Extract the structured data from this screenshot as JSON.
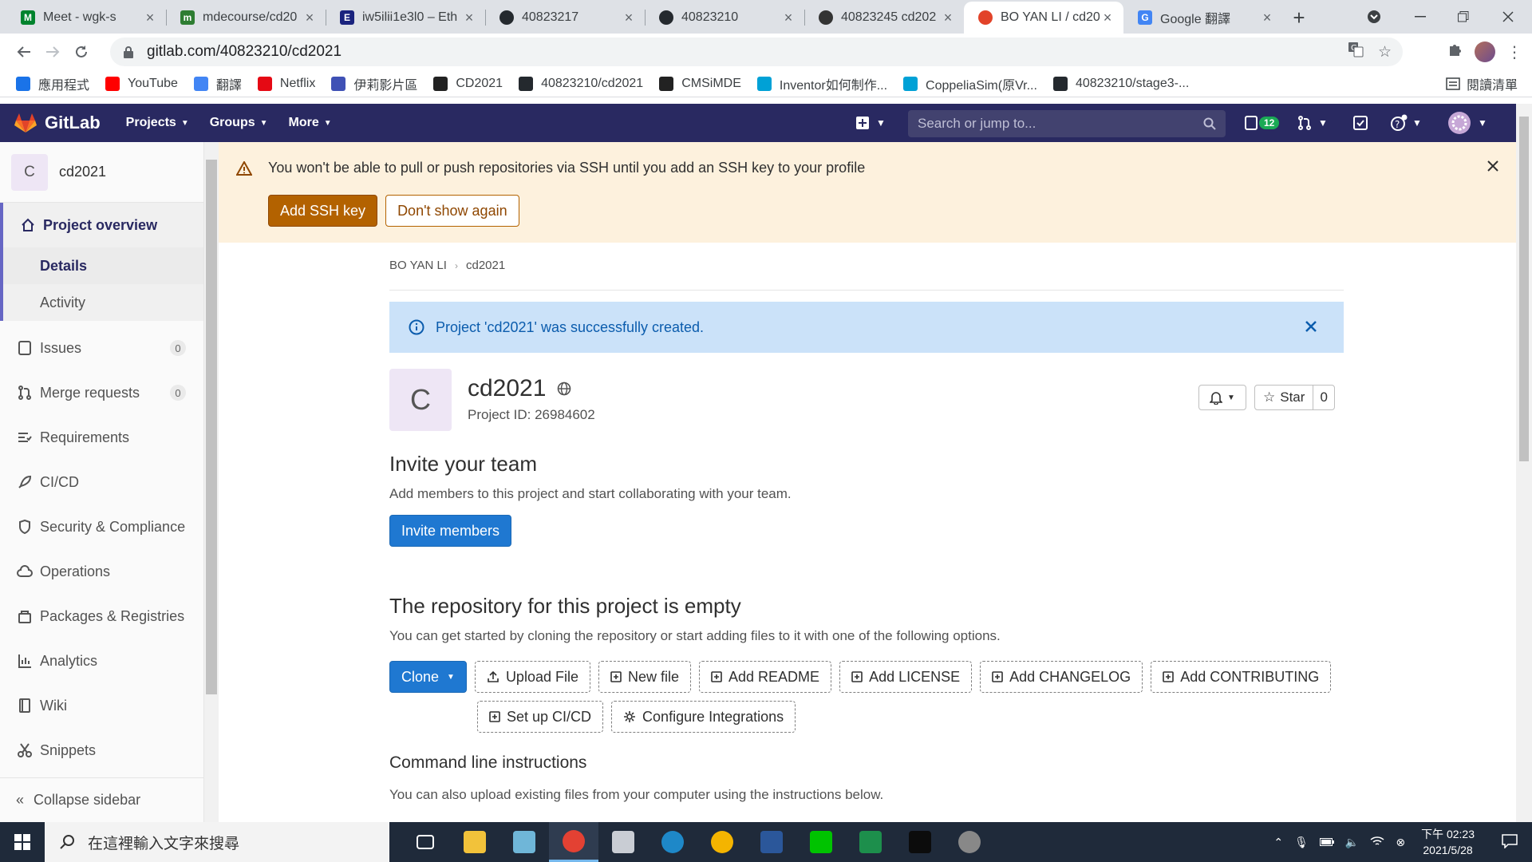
{
  "browser": {
    "tabs": [
      {
        "title": "Meet - wgk-s",
        "favicon_color": "#00832d",
        "favicon_letter": "M"
      },
      {
        "title": "mdecourse/cd20",
        "favicon_color": "#2e7d32",
        "favicon_letter": "m"
      },
      {
        "title": "iw5ilii1e3l0 – Eth",
        "favicon_color": "#1a237e",
        "favicon_letter": "E"
      },
      {
        "title": "40823217",
        "favicon_color": "#24292e",
        "favicon_letter": ""
      },
      {
        "title": "40823210",
        "favicon_color": "#24292e",
        "favicon_letter": ""
      },
      {
        "title": "40823245 cd202",
        "favicon_color": "#333333",
        "favicon_letter": ""
      },
      {
        "title": "BO YAN LI / cd20",
        "favicon_color": "#e24329",
        "favicon_letter": "",
        "active": true
      },
      {
        "title": "Google 翻譯",
        "favicon_color": "#4285f4",
        "favicon_letter": "G"
      }
    ],
    "url": "gitlab.com/40823210/cd2021",
    "bookmarks": [
      {
        "label": "應用程式",
        "icon": "apps-grid-icon",
        "color": "#1a73e8"
      },
      {
        "label": "YouTube",
        "icon": "youtube-icon",
        "color": "#ff0000"
      },
      {
        "label": "翻譯",
        "icon": "translate-icon",
        "color": "#4285f4"
      },
      {
        "label": "Netflix",
        "icon": "netflix-icon",
        "color": "#e50914"
      },
      {
        "label": "伊莉影片區",
        "icon": "eyny-icon",
        "color": "#3f51b5"
      },
      {
        "label": "CD2021",
        "icon": "cd-icon",
        "color": "#222222"
      },
      {
        "label": "40823210/cd2021",
        "icon": "github-icon",
        "color": "#24292e"
      },
      {
        "label": "CMSiMDE",
        "icon": "cms-icon",
        "color": "#222222"
      },
      {
        "label": "Inventor如何制作...",
        "icon": "bilibili-icon",
        "color": "#00a1d6"
      },
      {
        "label": "CoppeliaSim(原Vr...",
        "icon": "bilibili-icon",
        "color": "#00a1d6"
      },
      {
        "label": "40823210/stage3-...",
        "icon": "github-icon",
        "color": "#24292e"
      }
    ],
    "reading_list": "閱讀清單"
  },
  "gitlab": {
    "brand": "GitLab",
    "menu": [
      "Projects",
      "Groups",
      "More"
    ],
    "search_placeholder": "Search or jump to...",
    "issues_count": "12"
  },
  "sidebar": {
    "project_initial": "C",
    "project_name": "cd2021",
    "overview": {
      "label": "Project overview",
      "subitems": [
        "Details",
        "Activity"
      ],
      "active_sub": "Details"
    },
    "items": [
      {
        "label": "Issues",
        "count": "0",
        "icon": "issues-icon"
      },
      {
        "label": "Merge requests",
        "count": "0",
        "icon": "merge-request-icon"
      },
      {
        "label": "Requirements",
        "icon": "requirements-icon"
      },
      {
        "label": "CI/CD",
        "icon": "rocket-icon"
      },
      {
        "label": "Security & Compliance",
        "icon": "shield-icon"
      },
      {
        "label": "Operations",
        "icon": "cloud-gear-icon"
      },
      {
        "label": "Packages & Registries",
        "icon": "package-icon"
      },
      {
        "label": "Analytics",
        "icon": "chart-icon"
      },
      {
        "label": "Wiki",
        "icon": "book-icon"
      },
      {
        "label": "Snippets",
        "icon": "scissors-icon"
      }
    ],
    "collapse": "Collapse sidebar"
  },
  "ssh_banner": {
    "message": "You won't be able to pull or push repositories via SSH until you add an SSH key to your profile",
    "add_key": "Add SSH key",
    "dont_show": "Don't show again"
  },
  "breadcrumb": [
    "BO YAN LI",
    "cd2021"
  ],
  "flash": "Project 'cd2021' was successfully created.",
  "project": {
    "initial": "C",
    "name": "cd2021",
    "id_text": "Project ID: 26984602",
    "star_label": "Star",
    "star_count": "0"
  },
  "invite": {
    "title": "Invite your team",
    "text": "Add members to this project and start collaborating with your team.",
    "button": "Invite members"
  },
  "empty_repo": {
    "title": "The repository for this project is empty",
    "text": "You can get started by cloning the repository or start adding files to it with one of the following options.",
    "clone": "Clone",
    "buttons": [
      "Upload File",
      "New file",
      "Add README",
      "Add LICENSE",
      "Add CHANGELOG",
      "Add CONTRIBUTING"
    ],
    "buttons2": [
      "Set up CI/CD",
      "Configure Integrations"
    ]
  },
  "cli": {
    "title": "Command line instructions",
    "text": "You can also upload existing files from your computer using the instructions below."
  },
  "taskbar": {
    "search_placeholder": "在這裡輸入文字來搜尋",
    "time_ampm": "下午 02:23",
    "date": "2021/5/28"
  }
}
